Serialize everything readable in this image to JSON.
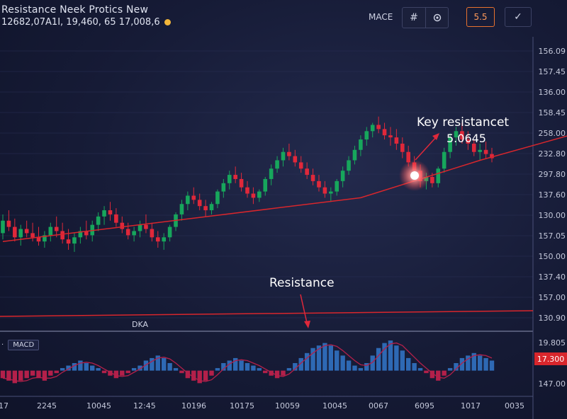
{
  "header": {
    "title": "Resistance Neek Protics New",
    "ticker": "12682,07A1I,  19,460, 65 17,008,6",
    "macd_label": "MACE",
    "buttons": [
      {
        "label": "#",
        "icon": "grid-icon"
      },
      {
        "label": "",
        "icon": "settings-icon"
      },
      {
        "label": "5.5",
        "icon": ""
      },
      {
        "label": "✓",
        "icon": "check-icon"
      }
    ]
  },
  "y_axis_labels": [
    "156.09",
    "157.45",
    "136.00",
    "158.45",
    "258.00",
    "232.80",
    "297.80",
    "137.60",
    "130.00",
    "157.05",
    "150.00",
    "137.40",
    "157.00",
    "130.90"
  ],
  "lower_y_labels": [
    "19.805",
    "147.00"
  ],
  "price_tag": "17.300",
  "x_axis_labels": [
    "17",
    "2245",
    "10045",
    "12:45",
    "10196",
    "10175",
    "10059",
    "10045",
    "0067",
    "6095",
    "1017",
    "0035"
  ],
  "annotations": {
    "key_resistance": "Key resistancet",
    "key_value": "5.0645",
    "resistance": "Resistance",
    "dka": "DKA"
  },
  "macd_panel_label": "MACD",
  "colors": {
    "bull": "#17a65c",
    "bear": "#e0283a",
    "trendline": "#d8262c",
    "macd_blue": "#2e69b4",
    "macd_red": "#b3204a",
    "highlight": "#ffffff"
  },
  "chart_data": {
    "type": "candlestick",
    "candles": [
      [
        154,
        163,
        151,
        160
      ],
      [
        160,
        165,
        155,
        157
      ],
      [
        157,
        161,
        150,
        152
      ],
      [
        152,
        158,
        148,
        156
      ],
      [
        156,
        160,
        152,
        154
      ],
      [
        154,
        159,
        150,
        152
      ],
      [
        152,
        157,
        148,
        150
      ],
      [
        150,
        155,
        147,
        153
      ],
      [
        153,
        159,
        150,
        157
      ],
      [
        157,
        162,
        152,
        155
      ],
      [
        155,
        159,
        149,
        151
      ],
      [
        151,
        156,
        146,
        149
      ],
      [
        149,
        154,
        145,
        152
      ],
      [
        152,
        157,
        149,
        155
      ],
      [
        155,
        160,
        151,
        153
      ],
      [
        153,
        160,
        150,
        158
      ],
      [
        158,
        164,
        155,
        162
      ],
      [
        162,
        167,
        158,
        165
      ],
      [
        165,
        169,
        160,
        163
      ],
      [
        163,
        166,
        157,
        159
      ],
      [
        159,
        162,
        154,
        156
      ],
      [
        156,
        159,
        151,
        153
      ],
      [
        153,
        157,
        150,
        155
      ],
      [
        155,
        160,
        152,
        158
      ],
      [
        158,
        163,
        154,
        156
      ],
      [
        156,
        159,
        150,
        152
      ],
      [
        152,
        155,
        147,
        150
      ],
      [
        150,
        154,
        146,
        152
      ],
      [
        152,
        158,
        150,
        157
      ],
      [
        157,
        164,
        155,
        163
      ],
      [
        163,
        170,
        160,
        168
      ],
      [
        168,
        174,
        165,
        172
      ],
      [
        172,
        176,
        168,
        170
      ],
      [
        170,
        173,
        165,
        167
      ],
      [
        167,
        170,
        162,
        165
      ],
      [
        165,
        169,
        163,
        168
      ],
      [
        168,
        175,
        166,
        174
      ],
      [
        174,
        180,
        171,
        178
      ],
      [
        178,
        184,
        175,
        182
      ],
      [
        182,
        186,
        178,
        180
      ],
      [
        180,
        183,
        174,
        176
      ],
      [
        176,
        179,
        171,
        173
      ],
      [
        173,
        176,
        168,
        171
      ],
      [
        171,
        175,
        169,
        174
      ],
      [
        174,
        181,
        172,
        180
      ],
      [
        180,
        187,
        177,
        185
      ],
      [
        185,
        191,
        183,
        189
      ],
      [
        189,
        195,
        186,
        193
      ],
      [
        193,
        197,
        189,
        191
      ],
      [
        191,
        194,
        186,
        188
      ],
      [
        188,
        191,
        183,
        185
      ],
      [
        185,
        188,
        180,
        182
      ],
      [
        182,
        185,
        177,
        179
      ],
      [
        179,
        182,
        174,
        176
      ],
      [
        176,
        179,
        171,
        173
      ],
      [
        173,
        176,
        169,
        174
      ],
      [
        174,
        180,
        172,
        179
      ],
      [
        179,
        186,
        176,
        184
      ],
      [
        184,
        191,
        182,
        189
      ],
      [
        189,
        196,
        187,
        194
      ],
      [
        194,
        201,
        191,
        199
      ],
      [
        199,
        205,
        196,
        203
      ],
      [
        203,
        207,
        200,
        206
      ],
      [
        206,
        210,
        202,
        204
      ],
      [
        204,
        207,
        199,
        201
      ],
      [
        201,
        205,
        196,
        200
      ],
      [
        200,
        204,
        194,
        197
      ],
      [
        197,
        200,
        190,
        193
      ],
      [
        193,
        196,
        186,
        188
      ],
      [
        188,
        191,
        181,
        184
      ],
      [
        184,
        187,
        176,
        179
      ],
      [
        179,
        183,
        175,
        181
      ],
      [
        181,
        183,
        176,
        178
      ],
      [
        178,
        186,
        176,
        185
      ],
      [
        185,
        195,
        183,
        193
      ],
      [
        193,
        202,
        190,
        200
      ],
      [
        200,
        205,
        196,
        203
      ],
      [
        203,
        207,
        197,
        199
      ],
      [
        199,
        203,
        194,
        197
      ],
      [
        197,
        199,
        191,
        193
      ],
      [
        193,
        197,
        189,
        194
      ],
      [
        194,
        198,
        190,
        192
      ],
      [
        192,
        195,
        188,
        190
      ]
    ],
    "trendline": [
      [
        0,
        150
      ],
      [
        60,
        171
      ],
      [
        80,
        189
      ],
      [
        100,
        205
      ]
    ],
    "macd_histogram": [
      -3,
      -4,
      -5,
      -4,
      -3,
      -2,
      -3,
      -4,
      -2,
      -1,
      1,
      2,
      3,
      4,
      3,
      2,
      1,
      -1,
      -2,
      -3,
      -2,
      -1,
      1,
      2,
      4,
      5,
      6,
      5,
      3,
      1,
      -1,
      -3,
      -4,
      -5,
      -4,
      -2,
      1,
      3,
      4,
      5,
      4,
      3,
      2,
      1,
      -1,
      -2,
      -3,
      -2,
      1,
      3,
      5,
      7,
      9,
      10,
      11,
      10,
      8,
      6,
      4,
      2,
      1,
      3,
      6,
      9,
      11,
      12,
      10,
      8,
      5,
      3,
      1,
      -1,
      -3,
      -4,
      -2,
      1,
      3,
      5,
      6,
      7,
      6,
      5,
      4
    ],
    "ylim": [
      130,
      215
    ],
    "macd_ylim": [
      -8,
      14
    ],
    "grid": true
  }
}
